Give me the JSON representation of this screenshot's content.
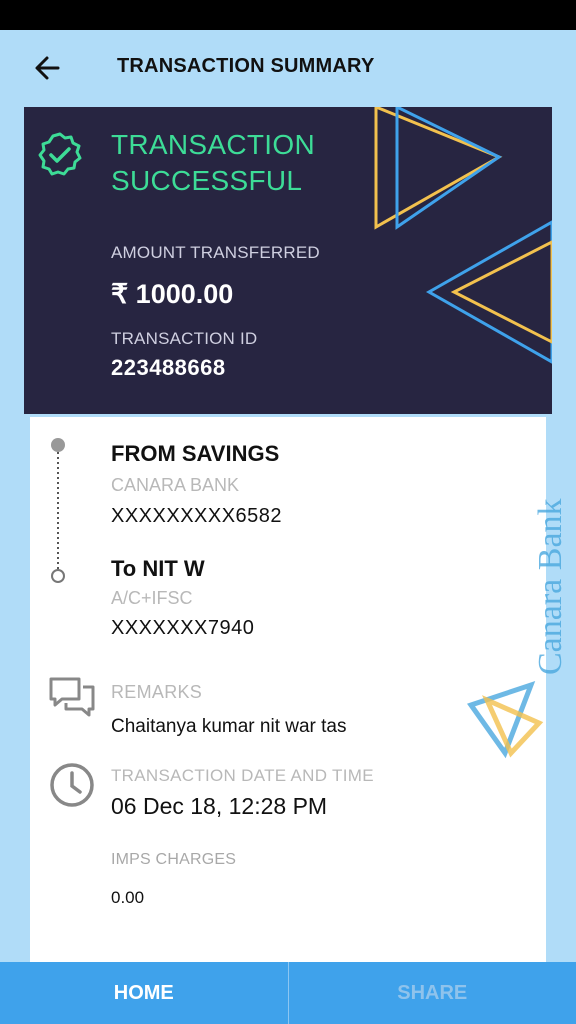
{
  "header": {
    "title": "TRANSACTION SUMMARY"
  },
  "status": {
    "text": "TRANSACTION SUCCESSFUL",
    "amount_label": "AMOUNT TRANSFERRED",
    "amount": "₹ 1000.00",
    "txid_label": "TRANSACTION ID",
    "txid": "223488668"
  },
  "from": {
    "title": "FROM SAVINGS",
    "bank": "CANARA BANK",
    "account": "XXXXXXXXX6582"
  },
  "to": {
    "title": "To NIT W",
    "type": "A/C+IFSC",
    "account": "XXXXXXX7940"
  },
  "remarks": {
    "label": "REMARKS",
    "value": "Chaitanya kumar nit war tas"
  },
  "datetime": {
    "label": "TRANSACTION DATE AND TIME",
    "value": "06 Dec 18, 12:28 PM"
  },
  "imps": {
    "label": "IMPS CHARGES",
    "value": "0.00"
  },
  "watermark": "Canara Bank",
  "bottom_tabs": {
    "home": "HOME",
    "share": "SHARE"
  },
  "colors": {
    "card_bg": "#272541",
    "success": "#3ddc97",
    "accent_blue": "#3fa2eb",
    "accent_yellow": "#f2c14e",
    "page_bg": "#b0dcf8"
  },
  "icons": [
    "back-arrow-icon",
    "check-badge-icon",
    "chat-icon",
    "clock-icon"
  ]
}
